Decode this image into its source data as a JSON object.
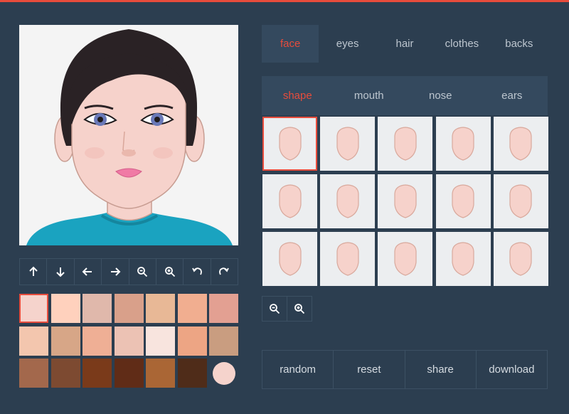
{
  "colors": {
    "accent": "#e74c3c",
    "background": "#2c3e50",
    "panel": "#34495e",
    "preview_bg": "#f4f4f4",
    "shirt": "#1aa3c0",
    "hair": "#2a2225"
  },
  "main_tabs": [
    {
      "label": "face",
      "active": true
    },
    {
      "label": "eyes",
      "active": false
    },
    {
      "label": "hair",
      "active": false
    },
    {
      "label": "clothes",
      "active": false
    },
    {
      "label": "backs",
      "active": false
    }
  ],
  "sub_tabs": [
    {
      "label": "shape",
      "active": true
    },
    {
      "label": "mouth",
      "active": false
    },
    {
      "label": "nose",
      "active": false
    },
    {
      "label": "ears",
      "active": false
    }
  ],
  "toolbar": [
    {
      "icon": "arrow-up-icon"
    },
    {
      "icon": "arrow-down-icon"
    },
    {
      "icon": "arrow-left-icon"
    },
    {
      "icon": "arrow-right-icon"
    },
    {
      "icon": "zoom-out-icon"
    },
    {
      "icon": "zoom-in-icon"
    },
    {
      "icon": "rotate-left-icon"
    },
    {
      "icon": "rotate-right-icon"
    }
  ],
  "skin_colors": [
    "#f5d3cc",
    "#ffd1bd",
    "#e0b8ab",
    "#d9a08a",
    "#e8b896",
    "#f1ae90",
    "#e3a092",
    "#f3c6ae",
    "#d7a687",
    "#efaf95",
    "#ecc2b4",
    "#f8e4de",
    "#eda584",
    "#c99d80",
    "#a3684c",
    "#7d4a31",
    "#7a3a1a",
    "#602c17",
    "#aa6635",
    "#4f2c19",
    "#f5d3cc"
  ],
  "selected_skin_index": 0,
  "face_shape_count": 15,
  "selected_shape_index": 0,
  "zoom_controls": [
    {
      "icon": "zoom-out-icon"
    },
    {
      "icon": "zoom-in-icon"
    }
  ],
  "actions": [
    {
      "label": "random"
    },
    {
      "label": "reset"
    },
    {
      "label": "share"
    },
    {
      "label": "download"
    }
  ]
}
